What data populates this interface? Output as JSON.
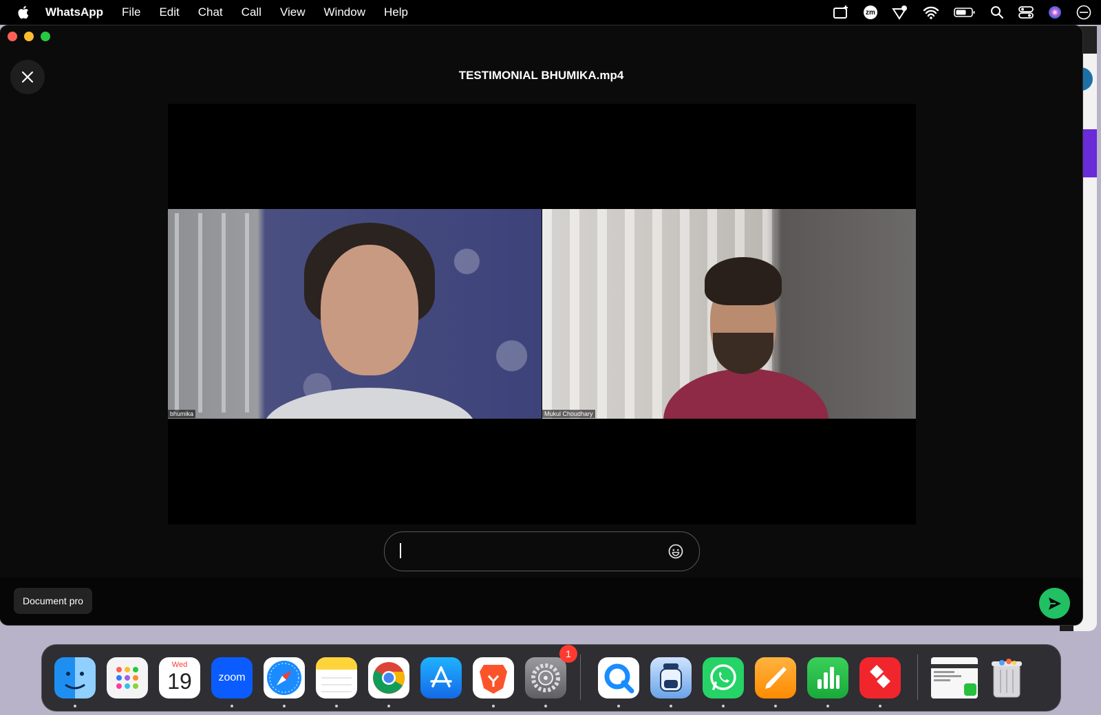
{
  "menubar": {
    "app_name": "WhatsApp",
    "items": [
      "File",
      "Edit",
      "Chat",
      "Call",
      "View",
      "Window",
      "Help"
    ],
    "zoom_status_label": "zm"
  },
  "viewer": {
    "title": "TESTIMONIAL BHUMIKA.mp4",
    "participants": [
      {
        "name": "bhumika"
      },
      {
        "name": "Mukul Choudhary"
      }
    ]
  },
  "caption": {
    "value": "",
    "placeholder": ""
  },
  "bottom_bar": {
    "document_label": "Document pro"
  },
  "dock": {
    "calendar_day": "Wed",
    "calendar_date": "19",
    "zoom_label": "zoom",
    "settings_badge": "1"
  },
  "colors": {
    "send_button": "#21c063",
    "badge": "#ff3b30",
    "window_bg": "#0b0b0b"
  },
  "icons": {
    "close": "close-icon",
    "emoji": "emoji-icon",
    "send": "send-icon"
  }
}
